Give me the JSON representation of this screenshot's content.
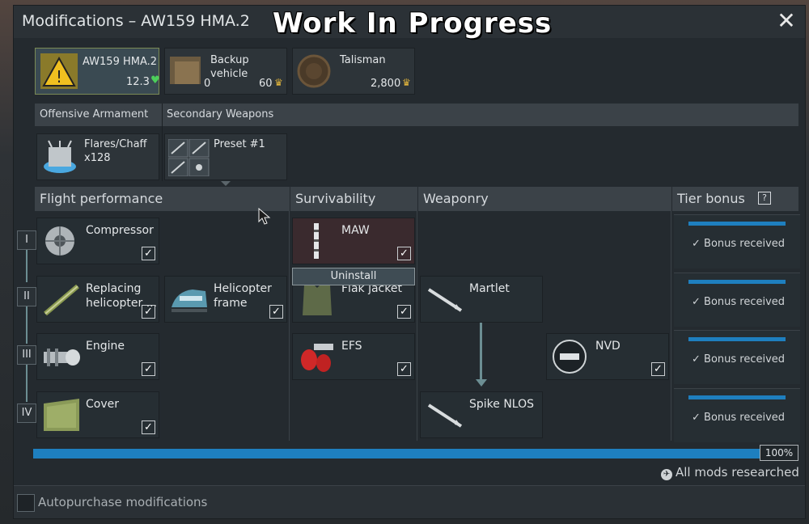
{
  "window": {
    "title": "Modifications – AW159 HMA.2",
    "overlay_text": "Work In Progress",
    "close_label": "✕"
  },
  "top_cards": {
    "vehicle": {
      "name": "AW159 HMA.2",
      "rank": "12.3"
    },
    "backup": {
      "label": "Backup\nvehicle",
      "count": "0",
      "cost": "60"
    },
    "talisman": {
      "label": "Talisman",
      "cost": "2,800"
    }
  },
  "armament": {
    "offensive_label": "Offensive Armament",
    "secondary_label": "Secondary Weapons",
    "offensive_item": "Flares/Chaff\nx128",
    "secondary_item": "Preset #1"
  },
  "columns": {
    "flight": "Flight performance",
    "survivability": "Survivability",
    "weaponry": "Weaponry",
    "tier_bonus": "Tier bonus",
    "tier_bonus_help": "?"
  },
  "tiers": [
    "I",
    "II",
    "III",
    "IV"
  ],
  "mods": {
    "compressor": "Compressor",
    "replacing": "Replacing\nhelicopter ...",
    "frame": "Helicopter\nframe",
    "engine": "Engine",
    "cover": "Cover",
    "maw": "MAW",
    "flak": "Flak jacket",
    "efs": "EFS",
    "martlet": "Martlet",
    "spike": "Spike NLOS",
    "nvd": "NVD"
  },
  "context_menu": {
    "uninstall": "Uninstall"
  },
  "tier_bonus": [
    "Bonus received",
    "Bonus received",
    "Bonus received",
    "Bonus received"
  ],
  "progress": {
    "value": 1.0,
    "percent_label": "100%",
    "status": "All mods researched"
  },
  "footer": {
    "autopurchase": "Autopurchase modifications"
  },
  "colors": {
    "accent": "#1e7fbf",
    "check": "#ffffff",
    "rank_heart": "#4ccf5a",
    "gold": "#e0b43c"
  }
}
